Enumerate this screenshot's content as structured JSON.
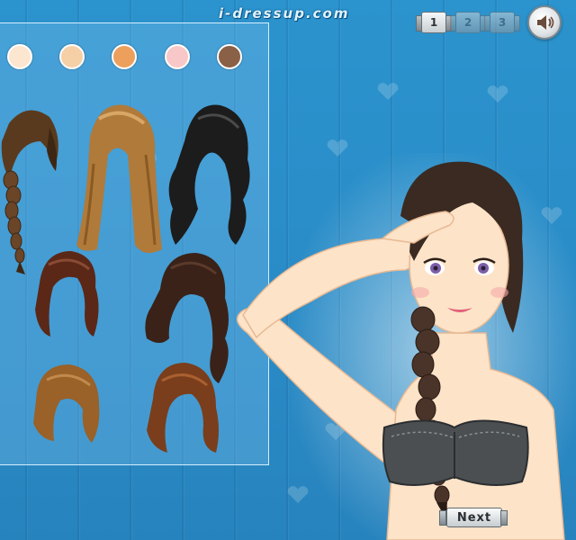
{
  "header": {
    "site_name": "i-dressup.com",
    "pages": [
      {
        "label": "1",
        "state": "active"
      },
      {
        "label": "2",
        "state": "inactive"
      },
      {
        "label": "3",
        "state": "inactive"
      }
    ],
    "sound_icon": "speaker-icon"
  },
  "skin_tones": [
    {
      "name": "skin-tone-1",
      "color": "#fde6cf"
    },
    {
      "name": "skin-tone-2",
      "color": "#f5cfa6"
    },
    {
      "name": "skin-tone-3",
      "color": "#eca05c"
    },
    {
      "name": "skin-tone-4",
      "color": "#f8c8c8"
    },
    {
      "name": "skin-tone-5",
      "color": "#8a6046"
    }
  ],
  "hairstyles": [
    {
      "name": "hairstyle-brown-braid",
      "color": "#5a3a1e"
    },
    {
      "name": "hairstyle-long-blonde",
      "color": "#b07a3a"
    },
    {
      "name": "hairstyle-black-wavy",
      "color": "#1c1c1c"
    },
    {
      "name": "hairstyle-auburn-updo",
      "color": "#5b2818"
    },
    {
      "name": "hairstyle-dark-brown-curls",
      "color": "#3a2218"
    },
    {
      "name": "hairstyle-light-brown-bob",
      "color": "#9a6128"
    },
    {
      "name": "hairstyle-chestnut-long",
      "color": "#7a3e1c"
    }
  ],
  "footer": {
    "next_label": "Next"
  }
}
